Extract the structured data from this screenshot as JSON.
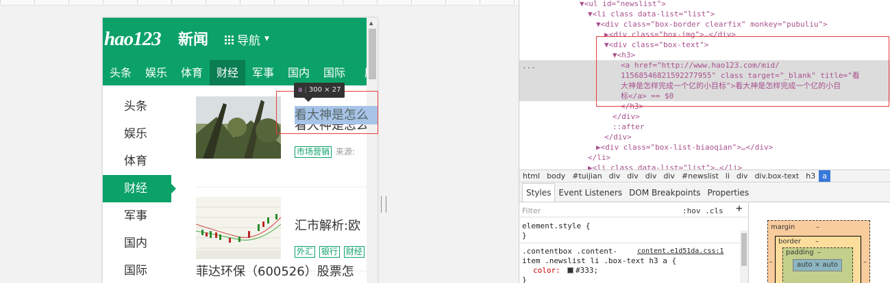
{
  "phone": {
    "logo": "hao123",
    "logo_cn": "新闻",
    "nav_label": "导航",
    "tabs": [
      "头条",
      "娱乐",
      "体育",
      "财经",
      "军事",
      "国内",
      "国际",
      "历"
    ],
    "active_tab": 3,
    "side": [
      "头条",
      "娱乐",
      "体育",
      "财经",
      "军事",
      "国内",
      "国际"
    ],
    "active_side": 3,
    "items": [
      {
        "title": "看大神是怎么",
        "tags": [
          "市场营销"
        ],
        "source": "来源:"
      },
      {
        "title": "汇市解析:欧",
        "tags": [
          "外汇",
          "银行",
          "财经"
        ],
        "source": ""
      }
    ],
    "item3_title": "菲达环保（600526）股票怎",
    "tooltip": {
      "tag": "a",
      "size": "300 × 27"
    }
  },
  "devtools": {
    "dom_lines": [
      {
        "l": "▼<ul id=\"newslist\">"
      },
      {
        "l": "▼<li class data-list=\"list\">"
      },
      {
        "l": "▼<div class=\"box-border clearfix\" monkey=\"pubuliu\">"
      },
      {
        "l": "▶<div class=\"box-img\">…</div>"
      },
      {
        "l": "▼<div class=\"box-text\">"
      },
      {
        "l": "▼<h3>"
      },
      {
        "l": "<a href=\"http://www.hao123.com/mid/"
      },
      {
        "l": "11568546821592277955\" class target=\"_blank\" title=\"看"
      },
      {
        "l": "大神是怎样完成一个亿的小目标\">看大神是怎样完成一个亿的小目"
      },
      {
        "l": "标</a> == $0"
      },
      {
        "l": "</h3>"
      },
      {
        "l": "</div>"
      },
      {
        "l": "::after"
      },
      {
        "l": "</div>"
      },
      {
        "l": "▶<div class=\"box-list-biaoqian\">…</div>"
      },
      {
        "l": "</li>"
      },
      {
        "l": "▶<li class data-list=\"list\">…</li>"
      }
    ],
    "breadcrumbs": [
      "html",
      "body",
      "#tuijian",
      "div",
      "div",
      "div",
      "div",
      "#newslist",
      "li",
      "div",
      "div.box-text",
      "h3",
      "a"
    ],
    "tabs": [
      "Styles",
      "Event Listeners",
      "DOM Breakpoints",
      "Properties"
    ],
    "filter_placeholder": "Filter",
    "hov_cls": ":hov  .cls",
    "styles": {
      "rule1_selector": "element.style {",
      "rule1_close": "}",
      "rule2_selector": ".contentbox .content-",
      "rule2_link": "content.e1d51da.css:1",
      "rule2_selector2": "item .newslist li .box-text h3 a {",
      "rule2_prop": "color:",
      "rule2_val": "#333;",
      "rule2_close": "}"
    },
    "boxmodel": {
      "margin": "margin",
      "border": "border",
      "padding": "padding",
      "content": "auto × auto",
      "dash": "–"
    }
  }
}
